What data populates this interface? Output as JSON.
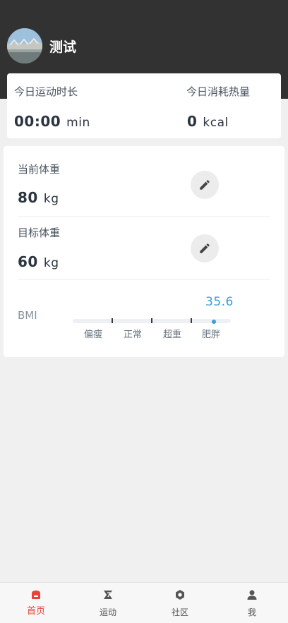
{
  "profile": {
    "username": "测试"
  },
  "today": {
    "duration_label": "今日运动时长",
    "duration_value": "00:00",
    "duration_unit": "min",
    "calories_label": "今日消耗热量",
    "calories_value": "0",
    "calories_unit": "kcal"
  },
  "weight": {
    "current_label": "当前体重",
    "current_value": "80",
    "current_unit": "kg",
    "target_label": "目标体重",
    "target_value": "60",
    "target_unit": "kg"
  },
  "bmi": {
    "label": "BMI",
    "value": "35.6",
    "categories": [
      "偏瘦",
      "正常",
      "超重",
      "肥胖"
    ]
  },
  "tabs": [
    {
      "label": "首页",
      "icon": "home-icon",
      "active": true
    },
    {
      "label": "运动",
      "icon": "sport-icon",
      "active": false
    },
    {
      "label": "社区",
      "icon": "community-icon",
      "active": false
    },
    {
      "label": "我",
      "icon": "person-icon",
      "active": false
    }
  ],
  "colors": {
    "header_bg": "#323232",
    "accent_red": "#e8443a",
    "bmi_blue": "#3a9be0"
  }
}
